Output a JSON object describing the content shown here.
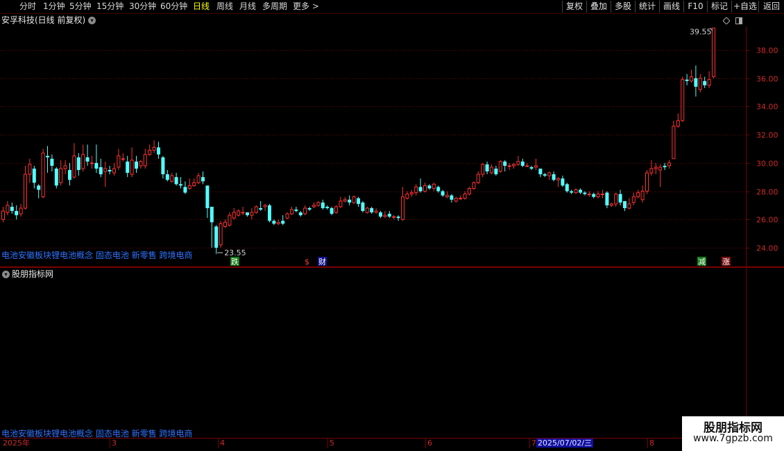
{
  "periods": [
    "分时",
    "1分钟",
    "5分钟",
    "15分钟",
    "30分钟",
    "60分钟",
    "日线",
    "周线",
    "月线",
    "多周期",
    "更多 >"
  ],
  "active_period": "日线",
  "tools": [
    "复权",
    "叠加",
    "多股",
    "统计",
    "画线",
    "F10",
    "标记",
    "+自选",
    "返回"
  ],
  "title": "安孚科技(日线 前复权)",
  "concepts": "电池安徽板块锂电池概念 固态电池 新零售 跨境电商",
  "indicator_pane_title": "股朋指标网",
  "watermark_line1": "股朋指标网",
  "watermark_line2": "www.7gpzb.com",
  "selected_date": "2025/07/02/三",
  "date_axis": [
    "2025年",
    "3",
    "4",
    "5",
    "6",
    "7",
    "8"
  ],
  "colors": {
    "up": "#ff3232",
    "down": "#54ffff",
    "grid": "#7a0000",
    "axis_text": "#cc2a2a",
    "concept": "#2f73ff",
    "active": "#ffff00"
  },
  "chart_data": {
    "type": "candlestick",
    "yticks": [
      24.0,
      26.0,
      28.0,
      30.0,
      32.0,
      34.0,
      36.0,
      38.0
    ],
    "ylim": [
      23.0,
      39.9
    ],
    "high_annotation": "39.55",
    "low_annotation": "23.55",
    "markers": [
      "跌",
      "$",
      "财",
      "减",
      "涨"
    ],
    "candles": [
      [
        26.0,
        26.6,
        25.8,
        26.9
      ],
      [
        26.5,
        27.0,
        26.3,
        27.3
      ],
      [
        26.9,
        26.6,
        26.4,
        27.2
      ],
      [
        26.6,
        26.3,
        26.0,
        27.0
      ],
      [
        26.4,
        26.8,
        26.2,
        27.1
      ],
      [
        26.8,
        29.2,
        26.7,
        29.8
      ],
      [
        29.2,
        29.9,
        28.6,
        30.3
      ],
      [
        29.6,
        28.6,
        28.2,
        29.8
      ],
      [
        28.4,
        28.1,
        27.5,
        28.5
      ],
      [
        27.6,
        30.7,
        27.5,
        31.0
      ],
      [
        30.5,
        30.4,
        29.3,
        31.2
      ],
      [
        30.3,
        29.8,
        29.4,
        30.6
      ],
      [
        29.6,
        28.4,
        28.2,
        29.7
      ],
      [
        28.6,
        29.6,
        28.4,
        30.2
      ],
      [
        29.6,
        29.8,
        29.2,
        30.2
      ],
      [
        29.5,
        28.8,
        28.4,
        30.0
      ],
      [
        29.0,
        30.5,
        28.9,
        31.4
      ],
      [
        30.4,
        29.5,
        29.1,
        30.7
      ],
      [
        29.6,
        30.6,
        29.4,
        31.3
      ],
      [
        30.4,
        30.1,
        29.8,
        31.3
      ],
      [
        30.0,
        30.0,
        29.6,
        30.5
      ],
      [
        30.0,
        29.6,
        29.3,
        31.3
      ],
      [
        29.7,
        29.2,
        29.0,
        30.3
      ],
      [
        29.4,
        29.6,
        28.3,
        30.1
      ],
      [
        29.5,
        29.4,
        29.2,
        29.8
      ],
      [
        29.3,
        29.6,
        29.1,
        30.0
      ],
      [
        29.7,
        30.5,
        29.5,
        31.0
      ],
      [
        30.3,
        30.3,
        30.1,
        30.7
      ],
      [
        30.1,
        29.3,
        29.0,
        30.5
      ],
      [
        29.2,
        30.2,
        29.0,
        31.1
      ],
      [
        30.1,
        29.6,
        29.3,
        30.5
      ],
      [
        29.8,
        30.1,
        29.6,
        30.2
      ],
      [
        29.8,
        30.6,
        29.6,
        31.0
      ],
      [
        30.6,
        30.9,
        30.5,
        31.3
      ],
      [
        30.9,
        31.1,
        30.7,
        31.6
      ],
      [
        31.1,
        30.6,
        30.3,
        31.5
      ],
      [
        30.4,
        29.2,
        28.9,
        30.5
      ],
      [
        29.2,
        28.8,
        28.7,
        29.5
      ],
      [
        28.7,
        29.1,
        28.6,
        29.3
      ],
      [
        29.0,
        28.5,
        28.4,
        29.3
      ],
      [
        28.5,
        28.4,
        28.2,
        29.0
      ],
      [
        28.3,
        27.9,
        27.8,
        28.7
      ],
      [
        28.2,
        28.4,
        28.1,
        28.9
      ],
      [
        28.4,
        28.6,
        28.3,
        28.9
      ],
      [
        28.6,
        29.1,
        28.5,
        29.3
      ],
      [
        29.0,
        28.7,
        28.5,
        29.4
      ],
      [
        28.4,
        26.8,
        26.1,
        28.4
      ],
      [
        26.9,
        25.8,
        24.0,
        26.9
      ],
      [
        25.5,
        24.0,
        23.55,
        25.6
      ],
      [
        24.2,
        25.7,
        24.0,
        25.9
      ],
      [
        25.5,
        25.8,
        25.4,
        26.0
      ],
      [
        25.6,
        26.3,
        25.5,
        26.5
      ],
      [
        26.1,
        26.5,
        26.0,
        26.8
      ],
      [
        26.3,
        26.6,
        26.2,
        26.7
      ],
      [
        26.5,
        26.5,
        26.3,
        26.9
      ],
      [
        26.5,
        26.3,
        26.2,
        26.5
      ],
      [
        26.3,
        26.5,
        26.0,
        26.8
      ],
      [
        26.5,
        26.9,
        26.4,
        27.0
      ],
      [
        26.8,
        26.7,
        26.6,
        27.3
      ],
      [
        26.9,
        27.0,
        26.6,
        27.1
      ],
      [
        27.0,
        25.9,
        25.8,
        27.1
      ],
      [
        25.9,
        25.7,
        25.6,
        26.0
      ],
      [
        25.7,
        25.8,
        25.6,
        26.0
      ],
      [
        25.9,
        25.7,
        25.6,
        26.3
      ],
      [
        26.1,
        26.4,
        26.0,
        26.5
      ],
      [
        26.4,
        26.7,
        26.3,
        26.9
      ],
      [
        26.7,
        26.6,
        26.5,
        26.9
      ],
      [
        26.5,
        26.3,
        26.2,
        26.6
      ],
      [
        26.4,
        26.8,
        26.3,
        27.0
      ],
      [
        26.8,
        26.7,
        26.6,
        26.9
      ],
      [
        26.9,
        27.0,
        26.8,
        27.2
      ],
      [
        27.0,
        27.2,
        26.9,
        27.3
      ],
      [
        27.2,
        26.8,
        26.7,
        27.4
      ],
      [
        26.9,
        26.8,
        26.7,
        27.0
      ],
      [
        26.8,
        26.4,
        26.3,
        26.9
      ],
      [
        26.5,
        26.9,
        26.4,
        27.0
      ],
      [
        26.9,
        27.3,
        26.8,
        27.6
      ],
      [
        27.3,
        27.4,
        27.2,
        27.6
      ],
      [
        27.4,
        27.2,
        27.0,
        27.7
      ],
      [
        27.2,
        27.6,
        27.1,
        27.7
      ],
      [
        27.5,
        27.1,
        26.9,
        27.6
      ],
      [
        27.2,
        26.6,
        26.5,
        27.3
      ],
      [
        26.5,
        26.8,
        26.4,
        26.9
      ],
      [
        26.8,
        26.5,
        26.4,
        26.9
      ],
      [
        26.5,
        26.6,
        26.4,
        26.8
      ],
      [
        26.5,
        26.2,
        26.1,
        26.6
      ],
      [
        26.2,
        26.3,
        26.1,
        26.6
      ],
      [
        26.4,
        26.2,
        26.1,
        26.6
      ],
      [
        26.2,
        26.2,
        26.0,
        26.3
      ],
      [
        26.2,
        26.1,
        25.9,
        26.3
      ],
      [
        26.0,
        27.6,
        25.9,
        28.3
      ],
      [
        27.5,
        27.8,
        27.4,
        28.0
      ],
      [
        27.8,
        27.9,
        27.6,
        28.1
      ],
      [
        27.9,
        28.3,
        27.7,
        28.5
      ],
      [
        28.3,
        28.0,
        27.9,
        28.9
      ],
      [
        28.0,
        28.4,
        27.9,
        28.6
      ],
      [
        28.4,
        28.2,
        28.1,
        28.5
      ],
      [
        28.2,
        28.5,
        28.0,
        28.6
      ],
      [
        28.3,
        28.0,
        27.9,
        28.4
      ],
      [
        28.0,
        27.7,
        27.6,
        28.1
      ],
      [
        27.6,
        27.7,
        27.5,
        28.0
      ],
      [
        27.7,
        27.4,
        27.2,
        27.8
      ],
      [
        27.3,
        27.5,
        27.2,
        27.6
      ],
      [
        27.5,
        27.5,
        27.4,
        27.7
      ],
      [
        27.5,
        27.8,
        27.4,
        28.0
      ],
      [
        27.8,
        28.2,
        27.7,
        28.3
      ],
      [
        28.2,
        28.6,
        28.1,
        28.7
      ],
      [
        28.6,
        29.2,
        28.5,
        29.4
      ],
      [
        29.2,
        29.9,
        29.0,
        30.0
      ],
      [
        29.9,
        29.4,
        29.2,
        30.1
      ],
      [
        29.3,
        29.7,
        29.2,
        29.9
      ],
      [
        29.6,
        29.2,
        29.1,
        29.8
      ],
      [
        29.4,
        30.1,
        29.3,
        30.2
      ],
      [
        30.1,
        29.8,
        29.4,
        30.2
      ],
      [
        29.8,
        29.8,
        29.5,
        30.0
      ],
      [
        29.8,
        29.9,
        29.6,
        30.0
      ],
      [
        29.9,
        30.1,
        29.8,
        30.5
      ],
      [
        30.1,
        29.8,
        29.7,
        30.3
      ],
      [
        29.8,
        29.8,
        29.7,
        30.0
      ],
      [
        29.7,
        29.6,
        29.5,
        29.8
      ],
      [
        29.7,
        29.8,
        29.5,
        30.3
      ],
      [
        29.6,
        29.2,
        29.0,
        29.6
      ],
      [
        29.2,
        29.1,
        29.0,
        29.3
      ],
      [
        29.1,
        29.3,
        28.8,
        29.4
      ],
      [
        29.2,
        28.8,
        28.7,
        29.4
      ],
      [
        28.8,
        28.9,
        28.3,
        29.0
      ],
      [
        28.9,
        28.4,
        28.3,
        29.1
      ],
      [
        28.5,
        28.0,
        27.9,
        28.6
      ],
      [
        28.0,
        27.9,
        27.8,
        28.1
      ],
      [
        27.9,
        28.1,
        27.8,
        28.2
      ],
      [
        28.1,
        27.9,
        27.8,
        28.2
      ],
      [
        27.9,
        27.8,
        27.7,
        28.0
      ],
      [
        27.8,
        27.8,
        27.6,
        28.0
      ],
      [
        27.8,
        27.6,
        27.5,
        27.9
      ],
      [
        27.6,
        27.8,
        27.5,
        28.0
      ],
      [
        27.8,
        27.8,
        27.5,
        28.1
      ],
      [
        27.9,
        27.0,
        26.8,
        28.0
      ],
      [
        27.0,
        27.1,
        26.9,
        27.2
      ],
      [
        27.1,
        27.8,
        26.9,
        27.9
      ],
      [
        27.8,
        27.2,
        27.0,
        28.1
      ],
      [
        27.3,
        26.8,
        26.6,
        27.3
      ],
      [
        26.8,
        27.1,
        26.7,
        27.5
      ],
      [
        27.2,
        27.6,
        27.0,
        27.9
      ],
      [
        27.6,
        27.9,
        27.5,
        28.1
      ],
      [
        27.4,
        28.0,
        27.2,
        28.4
      ],
      [
        28.0,
        29.3,
        27.8,
        29.5
      ],
      [
        29.3,
        29.6,
        29.1,
        30.2
      ],
      [
        29.6,
        29.7,
        29.2,
        30.0
      ],
      [
        29.5,
        29.7,
        28.3,
        29.9
      ],
      [
        29.8,
        29.7,
        29.5,
        30.0
      ],
      [
        29.8,
        30.0,
        29.6,
        30.2
      ],
      [
        30.3,
        32.6,
        30.3,
        33.0
      ],
      [
        32.6,
        33.0,
        32.5,
        33.5
      ],
      [
        33.0,
        35.9,
        32.9,
        36.1
      ],
      [
        35.9,
        35.8,
        35.5,
        36.3
      ],
      [
        35.8,
        36.1,
        35.7,
        36.6
      ],
      [
        36.0,
        35.4,
        34.7,
        36.9
      ],
      [
        35.2,
        36.0,
        35.0,
        36.3
      ],
      [
        35.8,
        35.5,
        35.3,
        36.1
      ],
      [
        35.5,
        35.9,
        35.3,
        36.5
      ],
      [
        36.1,
        39.55,
        36.0,
        39.55
      ]
    ]
  }
}
